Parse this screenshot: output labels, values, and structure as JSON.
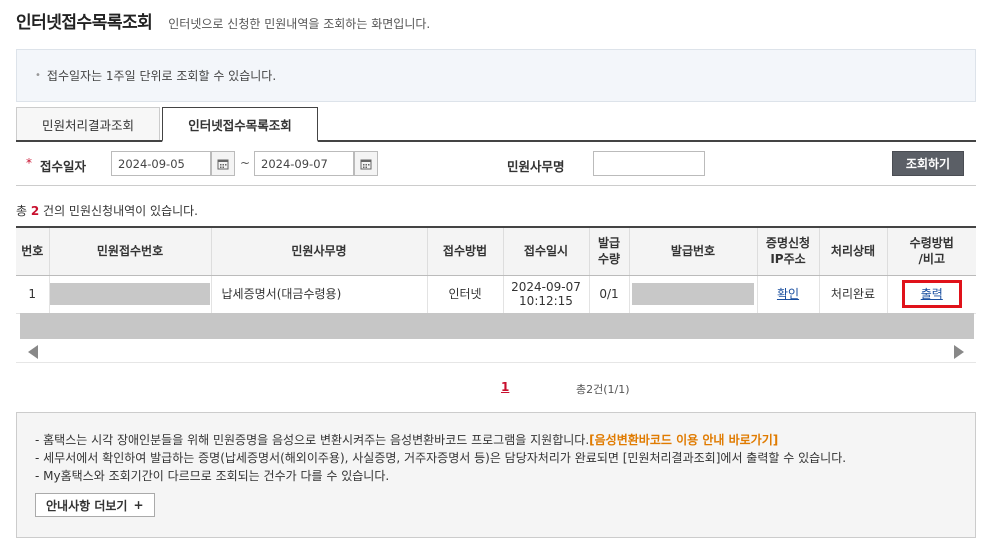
{
  "header": {
    "title": "인터넷접수목록조회",
    "description": "인터넷으로 신청한 민원내역을 조회하는 화면입니다."
  },
  "notice": {
    "text": "접수일자는 1주일 단위로 조회할 수 있습니다."
  },
  "tabs": [
    {
      "label": "민원처리결과조회",
      "active": false
    },
    {
      "label": "인터넷접수목록조회",
      "active": true
    }
  ],
  "search": {
    "date_label": "접수일자",
    "start_date": "2024-09-05",
    "end_date": "2024-09-07",
    "tilde": "~",
    "office_label": "민원사무명",
    "office_value": "",
    "button_label": "조회하기"
  },
  "summary": {
    "prefix": "총 ",
    "count": "2",
    "suffix": " 건의 민원신청내역이 있습니다."
  },
  "table": {
    "headers": {
      "no": "번호",
      "receipt_no": "민원접수번호",
      "office_name": "민원사무명",
      "method": "접수방법",
      "datetime": "접수일시",
      "qty_line1": "발급",
      "qty_line2": "수량",
      "issue_no": "발급번호",
      "ip_line1": "증명신청",
      "ip_line2": "IP주소",
      "status": "처리상태",
      "recv_line1": "수령방법",
      "recv_line2": "/비고"
    },
    "rows": [
      {
        "no": "1",
        "office_name": "납세증명서(대금수령용)",
        "method": "인터넷",
        "date": "2024-09-07",
        "time": "10:12:15",
        "qty": "0/1",
        "ip": "확인",
        "status": "처리완료",
        "receive": "출력"
      }
    ]
  },
  "paging": {
    "current": "1",
    "total": "총2건(1/1)"
  },
  "info": {
    "line1_text": "- 홈택스는 시각 장애인분들을 위해 민원증명을 음성으로 변환시켜주는 음성변환바코드 프로그램을 지원합니다.",
    "line1_link": "[음성변환바코드 이용 안내 바로가기]",
    "line2": "- 세무서에서 확인하여 발급하는 증명(납세증명서(해외이주용), 사실증명, 거주자증명서 등)은 담당자처리가 완료되면 [민원처리결과조회]에서 출력할 수 있습니다.",
    "line3": "- My홈택스와 조회기간이 다르므로 조회되는 건수가 다를 수 있습니다.",
    "more_button": "안내사항 더보기",
    "more_plus": "+"
  },
  "colors": {
    "accent_red": "#c8102e",
    "link_blue": "#1a4fa0",
    "highlight_orange": "#e07b00",
    "button_gray": "#5b5f66"
  }
}
